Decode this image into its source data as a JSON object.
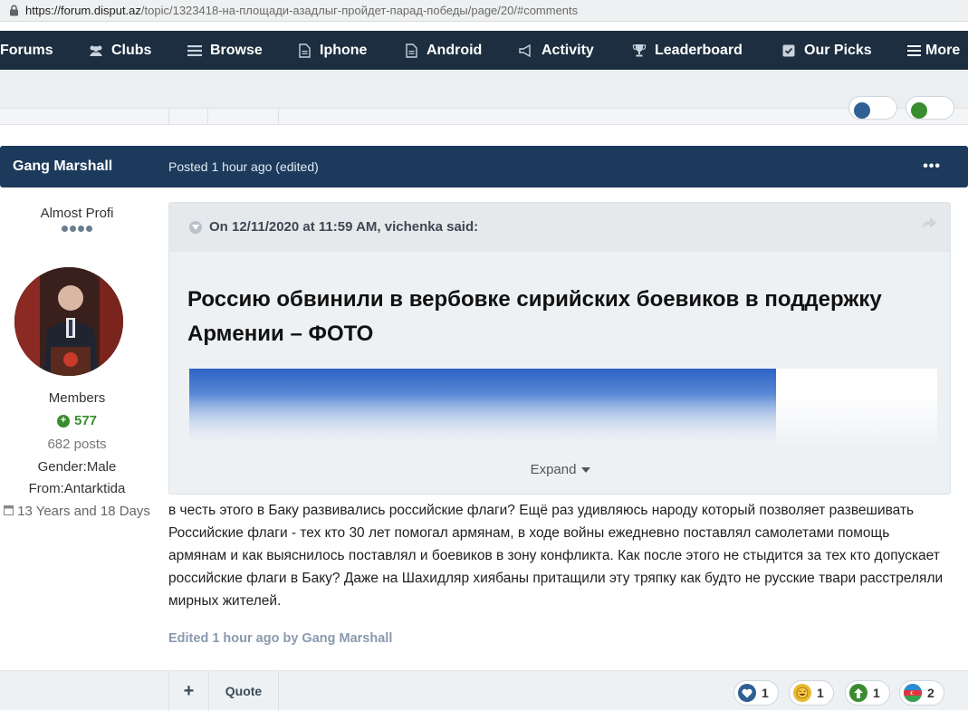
{
  "browser": {
    "url_host": "https://forum.disput.az",
    "url_path": "/topic/1323418-на-площади-азадлыг-пройдет-парад-победы/page/20/#comments"
  },
  "nav": {
    "items": [
      {
        "label": "Forums",
        "icon": "forums-icon"
      },
      {
        "label": "Clubs",
        "icon": "clubs-icon"
      },
      {
        "label": "Browse",
        "icon": "browse-icon"
      },
      {
        "label": "Iphone",
        "icon": "document-icon"
      },
      {
        "label": "Android",
        "icon": "document-icon"
      },
      {
        "label": "Activity",
        "icon": "activity-icon"
      },
      {
        "label": "Leaderboard",
        "icon": "trophy-icon"
      },
      {
        "label": "Our Picks",
        "icon": "picks-icon"
      },
      {
        "label": "More",
        "icon": "menu-icon"
      }
    ],
    "nav_bg": "#1c2e3f"
  },
  "post": {
    "author": "Gang Marshall",
    "posted": "Posted 1 hour ago (edited)",
    "more_label": "•••",
    "header_bg": "#1c3a5c"
  },
  "author_panel": {
    "rank_title": "Almost Profi",
    "group": "Members",
    "reputation": "577",
    "posts": "682 posts",
    "gender": "Gender:Male",
    "from": "From:Antarktida",
    "member_since": "13 Years and 18 Days"
  },
  "quote": {
    "citation": "On 12/11/2020 at 11:59 AM, vichenka said:",
    "title": "Россию обвинили в вербовке сирийских боевиков в поддержку Армении – ФОТО",
    "expand_label": "Expand"
  },
  "body": {
    "text": "в честь этого в Баку развивались российские флаги? Ещё раз удивляюсь народу который позволяет развешивать Российские флаги - тех кто 30 лет помогал армянам, в ходе войны ежедневно поставлял самолетами помощь армянам и как выяснилось поставлял и боевиков в зону конфликта. Как после этого не стыдится за тех кто допускает российские флаги в Баку? Даже на Шахидляр хиябаны притащили эту тряпку как будто не русские твари расстреляли мирных жителей.",
    "edited": "Edited 1 hour ago by Gang Marshall"
  },
  "footer": {
    "plus_label": "+",
    "quote_label": "Quote",
    "reactions": [
      {
        "name": "like",
        "count": "1",
        "color": "#2f5f95"
      },
      {
        "name": "haha",
        "count": "1",
        "color": "#e9b930"
      },
      {
        "name": "upvote",
        "count": "1",
        "color": "#3a8d2f"
      },
      {
        "name": "flag",
        "count": "2",
        "color": "#2a8bd1"
      }
    ]
  },
  "colors": {
    "reputation_green": "#3a8d2f",
    "edited_note": "#8a9aae"
  }
}
